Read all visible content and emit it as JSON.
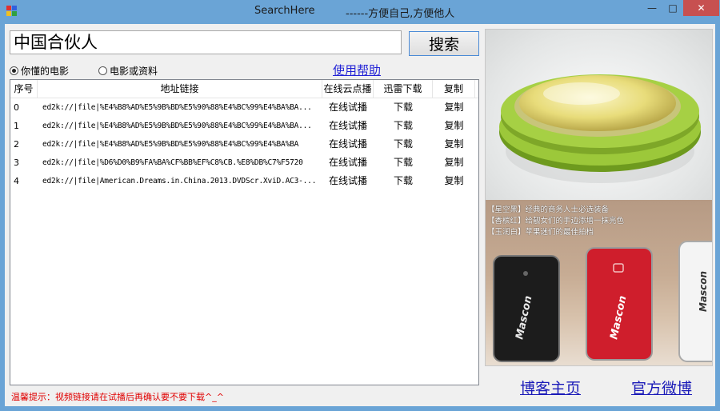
{
  "window": {
    "title": "SearchHere",
    "slogan": "------方便自己,方便他人",
    "controls": {
      "minimize": "—",
      "maximize": "□",
      "close": "✕"
    }
  },
  "search": {
    "query": "中国合伙人",
    "button_label": "搜索"
  },
  "options": {
    "radio_movies": "你懂的电影",
    "radio_docs": "电影或资料",
    "selected": "radio_movies",
    "help_link": "使用帮助"
  },
  "table": {
    "headers": [
      "序号",
      "地址链接",
      "在线云点播",
      "迅雷下载",
      "复制"
    ],
    "rows": [
      {
        "index": "0",
        "link": "ed2k://|file|%E4%B8%AD%E5%9B%BD%E5%90%88%E4%BC%99%E4%BA%BA...",
        "play": "在线试播",
        "download": "下载",
        "copy": "复制"
      },
      {
        "index": "1",
        "link": "ed2k://|file|%E4%B8%AD%E5%9B%BD%E5%90%88%E4%BC%99%E4%BA%BA...",
        "play": "在线试播",
        "download": "下载",
        "copy": "复制"
      },
      {
        "index": "2",
        "link": "ed2k://|file|%E4%B8%AD%E5%9B%BD%E5%90%88%E4%BC%99%E4%BA%BA",
        "play": "在线试播",
        "download": "下载",
        "copy": "复制"
      },
      {
        "index": "3",
        "link": "ed2k://|file|%D6%D0%B9%FA%BA%CF%BB%EF%C8%CB.%E8%DB%C7%F5720",
        "play": "在线试播",
        "download": "下载",
        "copy": "复制"
      },
      {
        "index": "4",
        "link": "ed2k://|file|American.Dreams.in.China.2013.DVDScr.XviD.AC3-...",
        "play": "在线试播",
        "download": "下载",
        "copy": "复制"
      }
    ]
  },
  "tip": "温馨提示：视频链接请在试播后再确认要不要下载^_^",
  "ads": {
    "lines": [
      "【星空黑】经典的商务人士必选装备",
      "【香槟红】给靓女们的手边添增一抹亮色",
      "【玉润白】苹果迷们的最佳拍档"
    ],
    "brand": "Mascon"
  },
  "links": {
    "blog": "博客主页",
    "weibo": "官方微博"
  }
}
